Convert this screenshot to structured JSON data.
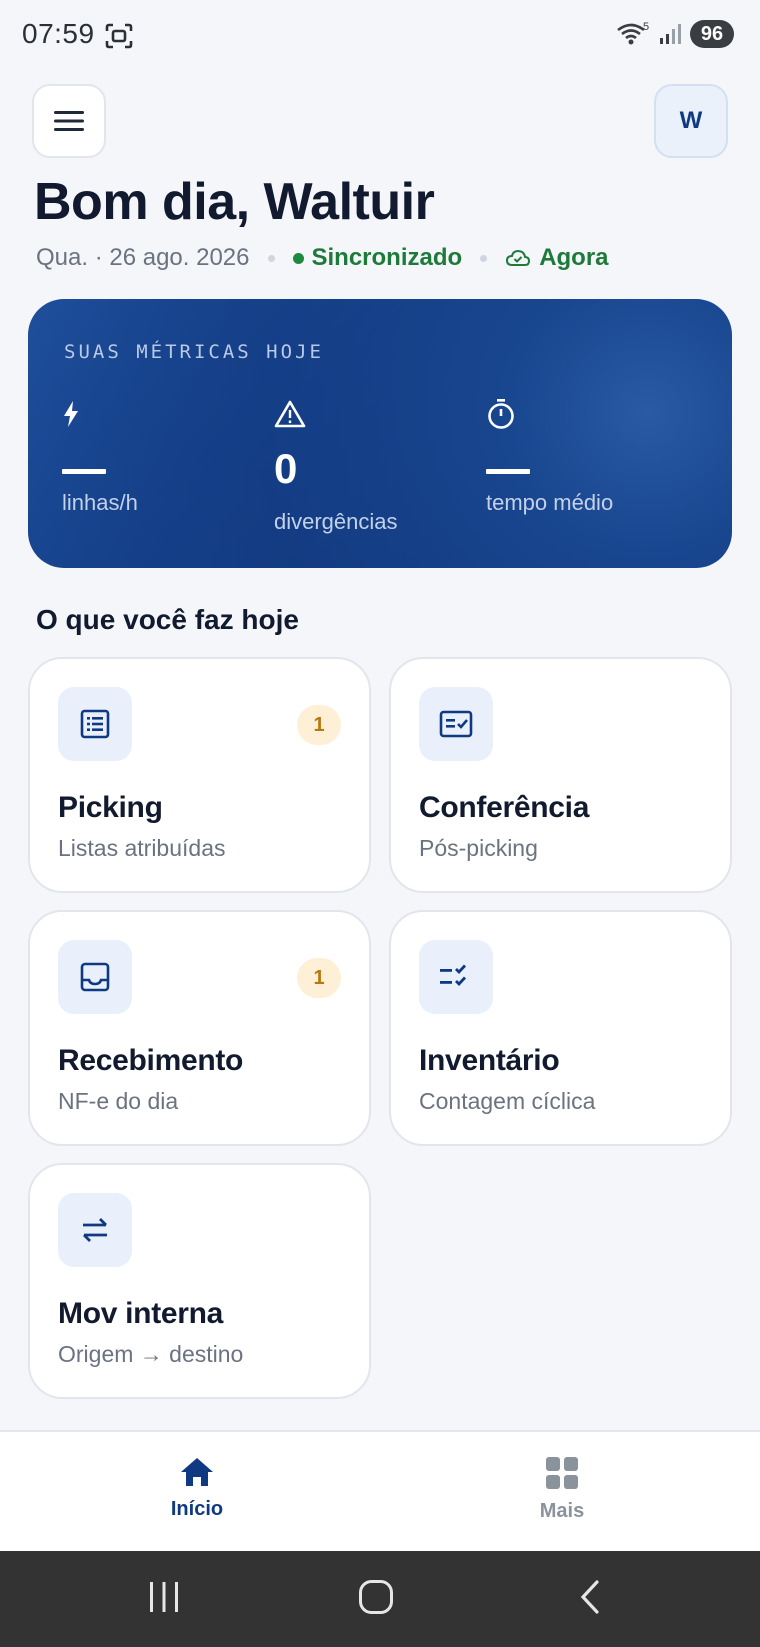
{
  "status_bar": {
    "time": "07:59",
    "wifi_label": "5",
    "battery": "96"
  },
  "header": {
    "avatar_initial": "W",
    "greeting": "Bom dia, Waltuir",
    "date": "Qua. · 26 ago. 2026",
    "sync_status": "Sincronizado",
    "sync_time": "Agora"
  },
  "metrics": {
    "title": "SUAS MÉTRICAS HOJE",
    "items": [
      {
        "icon": "lightning-icon",
        "value": "",
        "label": "linhas/h"
      },
      {
        "icon": "warning-icon",
        "value": "0",
        "label": "divergências"
      },
      {
        "icon": "stopwatch-icon",
        "value": "",
        "label": "tempo médio"
      }
    ]
  },
  "section": {
    "title": "O que você faz hoje"
  },
  "tasks": [
    {
      "icon": "list-icon",
      "title": "Picking",
      "subtitle": "Listas atribuídas",
      "badge": "1"
    },
    {
      "icon": "checklist-icon",
      "title": "Conferência",
      "subtitle": "Pós-picking",
      "badge": ""
    },
    {
      "icon": "inbox-icon",
      "title": "Recebimento",
      "subtitle": "NF-e do dia",
      "badge": "1"
    },
    {
      "icon": "list-check-icon",
      "title": "Inventário",
      "subtitle": "Contagem cíclica",
      "badge": ""
    },
    {
      "icon": "transfer-icon",
      "title": "Mov interna",
      "subtitle": "Origem → destino",
      "badge": ""
    }
  ],
  "bottom_nav": {
    "items": [
      {
        "icon": "home-icon",
        "label": "Início",
        "active": true
      },
      {
        "icon": "grid-icon",
        "label": "Mais",
        "active": false
      }
    ]
  },
  "colors": {
    "accent": "#0f3a82",
    "success": "#1e7a3a",
    "badge": "#b9770e",
    "inactive": "#8a929c"
  }
}
